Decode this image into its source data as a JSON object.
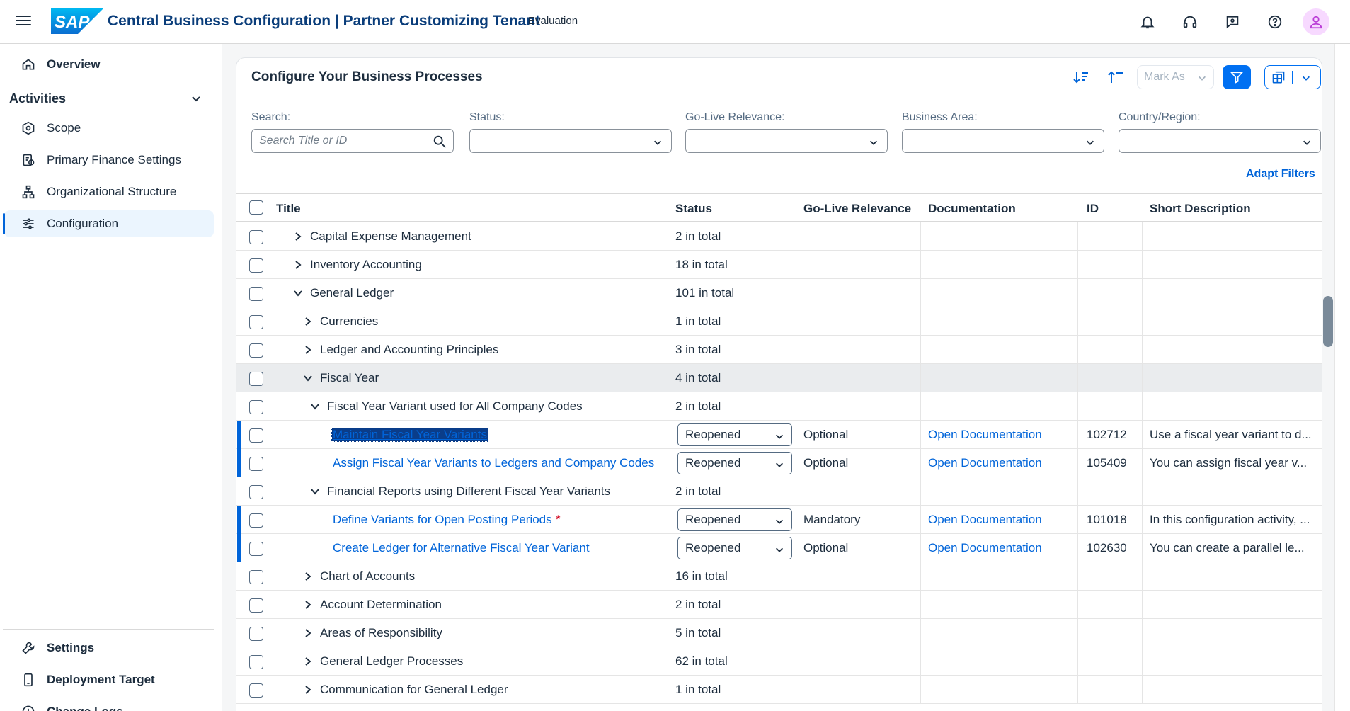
{
  "shell": {
    "logo_text": "SAP",
    "title": "Central Business Configuration | Partner Customizing Tenant",
    "subtitle": "Evaluation",
    "icons": [
      "bell-icon",
      "headset-icon",
      "feedback-icon",
      "help-icon",
      "user-icon"
    ],
    "colors": {
      "brand": "#0070f2",
      "title": "#0a3d7a",
      "avatar_bg": "#f7d9ff"
    }
  },
  "sidenav": {
    "overview": "Overview",
    "group": "Activities",
    "items": [
      "Scope",
      "Primary Finance Settings",
      "Organizational Structure",
      "Configuration"
    ],
    "selected": "Configuration",
    "bottom": [
      "Settings",
      "Deployment Target",
      "Change Logs"
    ]
  },
  "card": {
    "title": "Configure Your Business Processes",
    "mark_as": "Mark As",
    "adapt_filters": "Adapt Filters"
  },
  "filters": {
    "search_label": "Search:",
    "search_placeholder": "Search Title or ID",
    "status_label": "Status:",
    "golive_label": "Go-Live Relevance:",
    "area_label": "Business Area:",
    "country_label": "Country/Region:"
  },
  "table": {
    "columns": [
      "Title",
      "Status",
      "Go-Live Relevance",
      "Documentation",
      "ID",
      "Short Description"
    ],
    "rows": [
      {
        "title": "Capital Expense Management",
        "status": "2 in total",
        "level": 0,
        "expanded": false
      },
      {
        "title": "Inventory Accounting",
        "status": "18 in total",
        "level": 0,
        "expanded": false
      },
      {
        "title": "General Ledger",
        "status": "101 in total",
        "level": 0,
        "expanded": true
      },
      {
        "title": "Currencies",
        "status": "1 in total",
        "level": 1,
        "expanded": false
      },
      {
        "title": "Ledger and Accounting Principles",
        "status": "3 in total",
        "level": 1,
        "expanded": false
      },
      {
        "title": "Fiscal Year",
        "status": "4 in total",
        "level": 1,
        "expanded": true
      },
      {
        "title": "Fiscal Year Variant used for All Company Codes",
        "status": "2 in total",
        "level": 2,
        "expanded": true
      },
      {
        "title": "Maintain Fiscal Year Variants",
        "status": "Reopened",
        "golive": "Optional",
        "doc": "Open Documentation",
        "id": "102712",
        "desc": "Use a fiscal year variant to d..."
      },
      {
        "title": "Assign Fiscal Year Variants to Ledgers and Company Codes",
        "status": "Reopened",
        "golive": "Optional",
        "doc": "Open Documentation",
        "id": "105409",
        "desc": "You can assign fiscal year v..."
      },
      {
        "title": "Financial Reports using Different Fiscal Year Variants",
        "status": "2 in total",
        "level": 2,
        "expanded": true
      },
      {
        "title": "Define Variants for Open Posting Periods",
        "required": "*",
        "status": "Reopened",
        "golive": "Mandatory",
        "doc": "Open Documentation",
        "id": "101018",
        "desc": "In this configuration activity, ..."
      },
      {
        "title": "Create Ledger for Alternative Fiscal Year Variant",
        "status": "Reopened",
        "golive": "Optional",
        "doc": "Open Documentation",
        "id": "102630",
        "desc": "You can create a parallel le..."
      },
      {
        "title": "Chart of Accounts",
        "status": "16 in total",
        "level": 1,
        "expanded": false
      },
      {
        "title": "Account Determination",
        "status": "2 in total",
        "level": 1,
        "expanded": false
      },
      {
        "title": "Areas of Responsibility",
        "status": "5 in total",
        "level": 1,
        "expanded": false
      },
      {
        "title": "General Ledger Processes",
        "status": "62 in total",
        "level": 1,
        "expanded": false
      },
      {
        "title": "Communication for General Ledger",
        "status": "1 in total",
        "level": 1,
        "expanded": false
      }
    ]
  }
}
